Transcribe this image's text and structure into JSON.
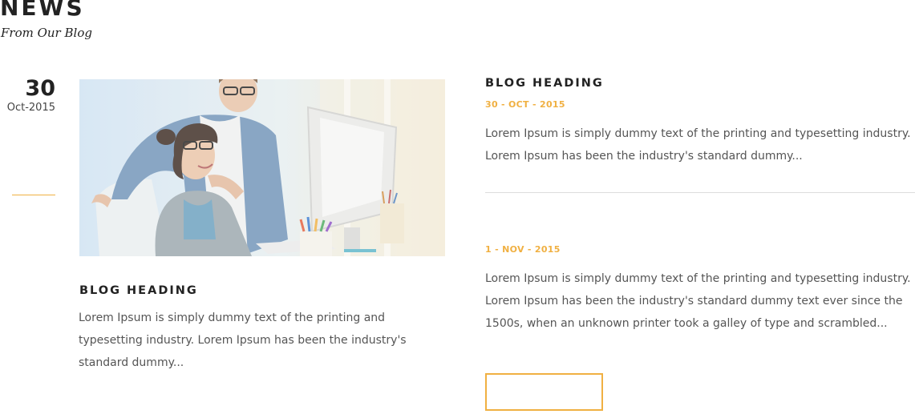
{
  "section": {
    "title": "NEWS",
    "subtitle": "From Our Blog"
  },
  "featured_post": {
    "day": "30",
    "month_year": "Oct-2015",
    "heading": "BLOG HEADING",
    "excerpt": "Lorem Ipsum is simply dummy text of the printing and typesetting industry. Lorem Ipsum has been the industry's standard dummy..."
  },
  "side_posts": [
    {
      "heading": "BLOG HEADING",
      "date": "30 - OCT - 2015",
      "excerpt": "Lorem Ipsum is simply dummy text of the printing and typesetting industry. Lorem Ipsum has been the industry's standard dummy..."
    },
    {
      "date": "1 - NOV - 2015",
      "excerpt": "Lorem Ipsum is simply dummy text of the printing and typesetting industry. Lorem Ipsum has been the industry's standard dummy text ever since the 1500s, when an unknown printer took a galley of type and scrambled..."
    }
  ],
  "colors": {
    "accent": "#f0b042",
    "heading": "#222222",
    "body_text": "#555555",
    "divider": "#dddddd"
  }
}
